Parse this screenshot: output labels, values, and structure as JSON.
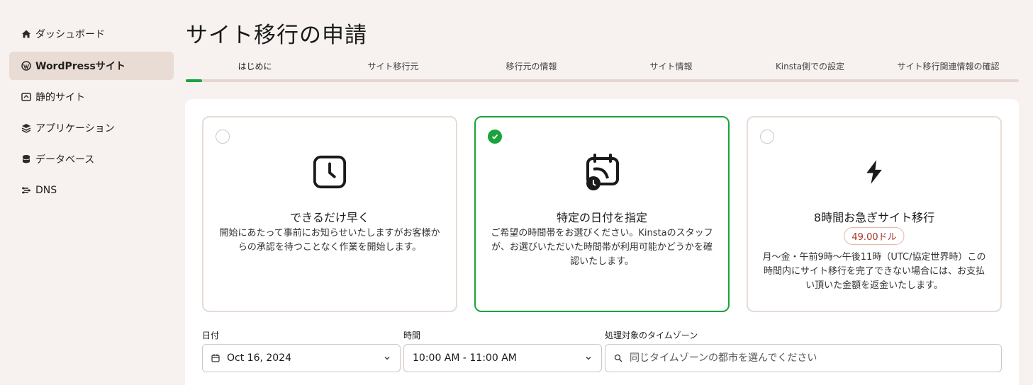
{
  "sidebar": {
    "items": [
      {
        "label": "ダッシュボード",
        "icon": "home-icon"
      },
      {
        "label": "WordPressサイト",
        "icon": "wordpress-icon",
        "active": true
      },
      {
        "label": "静的サイト",
        "icon": "static-site-icon"
      },
      {
        "label": "アプリケーション",
        "icon": "layers-icon"
      },
      {
        "label": "データベース",
        "icon": "database-icon"
      },
      {
        "label": "DNS",
        "icon": "dns-icon"
      }
    ]
  },
  "page": {
    "title": "サイト移行の申請"
  },
  "steps": {
    "items": [
      "はじめに",
      "サイト移行元",
      "移行元の情報",
      "サイト情報",
      "Kinsta側での設定",
      "サイト移行関連情報の確認"
    ],
    "active_index": 0,
    "progress_color": "#1aa33c"
  },
  "options": {
    "asap": {
      "title": "できるだけ早く",
      "description": "開始にあたって事前にお知らせいたしますがお客様からの承認を待つことなく作業を開始します。",
      "icon": "clock-icon",
      "selected": false
    },
    "scheduled": {
      "title": "特定の日付を指定",
      "description": "ご希望の時間帯をお選びください。Kinstaのスタッフが、お選びいただいた時間帯が利用可能かどうかを確認いたします。",
      "icon": "calendar-clock-icon",
      "selected": true
    },
    "express": {
      "title": "8時間お急ぎサイト移行",
      "price": "49.00ドル",
      "description": "月〜金・午前9時〜午後11時（UTC/協定世界時）この時間内にサイト移行を完了できない場合には、お支払い頂いた金額を返金いたします。",
      "icon": "lightning-icon",
      "selected": false
    }
  },
  "form": {
    "date_label": "日付",
    "date_value": "Oct 16, 2024",
    "time_label": "時間",
    "time_value": "10:00 AM - 11:00 AM",
    "timezone_label": "処理対象のタイムゾーン",
    "timezone_placeholder": "同じタイムゾーンの都市を選んでください"
  },
  "colors": {
    "accent": "#1aa33c",
    "background": "#f7f2ef",
    "price": "#a8322a"
  }
}
